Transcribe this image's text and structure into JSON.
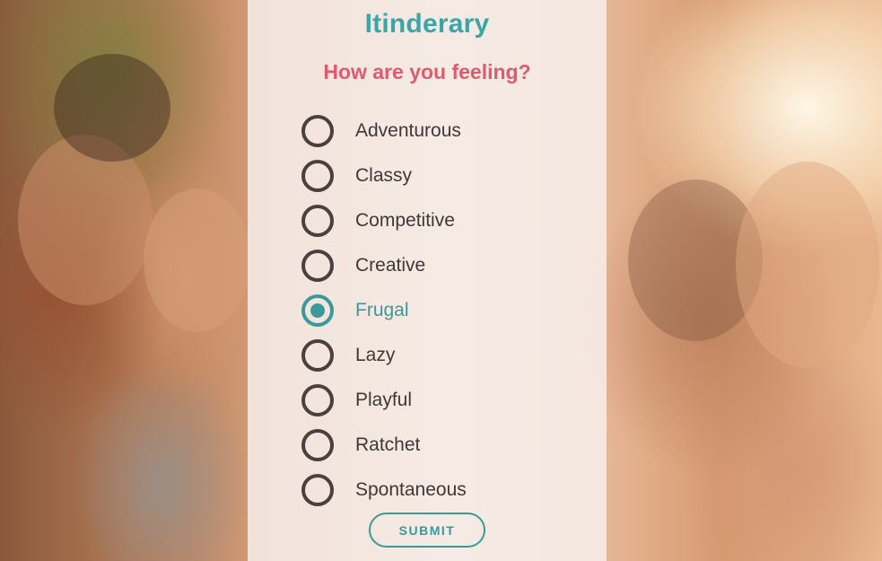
{
  "app": {
    "title": "Itinderary"
  },
  "form": {
    "question": "How are you feeling?",
    "options": [
      {
        "label": "Adventurous",
        "checked": false
      },
      {
        "label": "Classy",
        "checked": false
      },
      {
        "label": "Competitive",
        "checked": false
      },
      {
        "label": "Creative",
        "checked": false
      },
      {
        "label": "Frugal",
        "checked": true
      },
      {
        "label": "Lazy",
        "checked": false
      },
      {
        "label": "Playful",
        "checked": false
      },
      {
        "label": "Ratchet",
        "checked": false
      },
      {
        "label": "Spontaneous",
        "checked": false
      }
    ],
    "submit_label": "SUBMIT"
  },
  "colors": {
    "accent": "#3aa6a6",
    "question": "#e05a6e",
    "text": "#3f3838"
  }
}
